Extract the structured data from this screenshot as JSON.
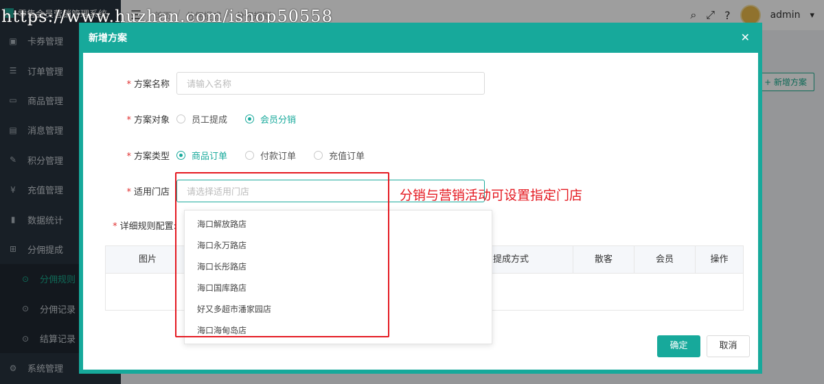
{
  "app": {
    "title": "零售会员营销管理系统"
  },
  "header": {
    "breadcrumb": [
      "首页",
      "分佣提成",
      "分佣规则"
    ],
    "username": "admin"
  },
  "sidebar": {
    "items": [
      {
        "label": "卡券管理",
        "icon": "card-icon"
      },
      {
        "label": "订单管理",
        "icon": "list-icon"
      },
      {
        "label": "商品管理",
        "icon": "monitor-icon"
      },
      {
        "label": "消息管理",
        "icon": "message-icon"
      },
      {
        "label": "积分管理",
        "icon": "edit-icon"
      },
      {
        "label": "充值管理",
        "icon": "yen-icon"
      },
      {
        "label": "数据统计",
        "icon": "bar-chart-icon"
      },
      {
        "label": "分佣提成",
        "icon": "sitemap-icon"
      }
    ],
    "submenu": [
      {
        "label": "分佣规则",
        "active": true
      },
      {
        "label": "分佣记录",
        "active": false
      },
      {
        "label": "结算记录",
        "active": false
      }
    ],
    "bottom_item": {
      "label": "系统管理",
      "icon": "gear-icon"
    }
  },
  "background": {
    "add_button": "+ 新增方案"
  },
  "modal": {
    "title": "新增方案",
    "fields": {
      "name": {
        "label": "方案名称",
        "placeholder": "请输入名称"
      },
      "target": {
        "label": "方案对象",
        "options": [
          "员工提成",
          "会员分销"
        ],
        "selected": "会员分销"
      },
      "type": {
        "label": "方案类型",
        "options": [
          "商品订单",
          "付款订单",
          "充值订单"
        ],
        "selected": "商品订单"
      },
      "store": {
        "label": "适用门店",
        "placeholder": "请选择适用门店"
      },
      "rules": {
        "label": "详细规则配置:"
      }
    },
    "table_headers": [
      "图片",
      "提成方式",
      "散客",
      "会员",
      "操作"
    ],
    "dropdown_options": [
      "海口解放路店",
      "海口永万路店",
      "海口长彤路店",
      "海口国库路店",
      "好又多超市潘家园店",
      "海口海甸岛店"
    ],
    "confirm_label": "确定",
    "cancel_label": "取消"
  },
  "annotation": {
    "text": "分销与营销活动可设置指定门店",
    "color": "#e4171f"
  },
  "watermark": "https://www.huzhan.com/ishop50558",
  "colors": {
    "accent": "#17a99b",
    "sidebar_bg": "#28333e"
  }
}
